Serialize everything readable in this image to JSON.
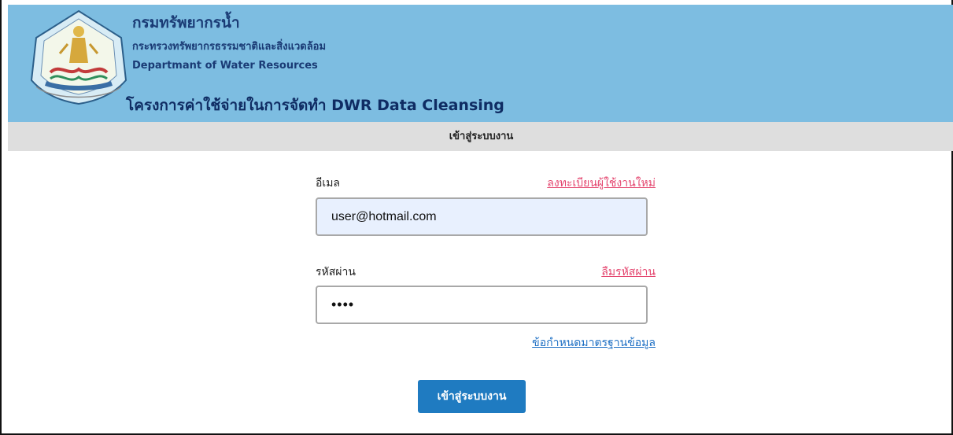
{
  "header": {
    "org_name_th": "กรมทรัพยากรน้ำ",
    "ministry_th": "กระทรวงทรัพยากรธรรมชาติและสิ่งแวดล้อม",
    "org_name_en": "Departmant of Water Resources",
    "project_title": "โครงการค่าใช้จ่ายในการจัดทำ DWR Data Cleansing",
    "logo_icon": "dwr-emblem-icon"
  },
  "subbar": {
    "title": "เข้าสู่ระบบงาน"
  },
  "form": {
    "email_label": "อีเมล",
    "register_link": "ลงทะเบียนผู้ใช้งานใหม่",
    "email_value": "user@hotmail.com",
    "password_label": "รหัสผ่าน",
    "forgot_link": "ลืมรหัสผ่าน",
    "password_value": "1234",
    "standards_link": "ข้อกำหนดมาตรฐานข้อมูล",
    "submit_label": "เข้าสู่ระบบงาน"
  },
  "colors": {
    "header_bg": "#7dbde1",
    "subbar_bg": "#dedede",
    "link_pink": "#e4466f",
    "link_blue": "#1d6fc4",
    "button_bg": "#1f7bc1"
  }
}
